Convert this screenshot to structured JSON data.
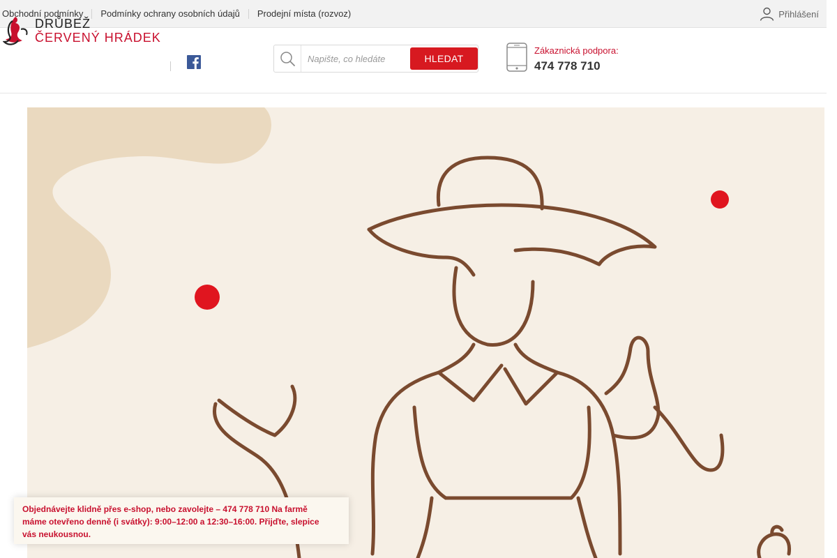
{
  "topbar": {
    "links": [
      "Obchodní podmínky",
      "Podmínky ochrany osobních údajů",
      "Prodejní místa (rozvoz)"
    ],
    "login_label": "Přihlášení",
    "login_icon": "user-icon"
  },
  "header": {
    "logo": {
      "line1": "DRŮBEŽ",
      "line2": "ČERVENÝ HRÁDEK"
    },
    "social_icon": "facebook-icon",
    "search": {
      "placeholder": "Napište, co hledáte",
      "button_label": "HLEDAT",
      "icon": "search-icon"
    },
    "support": {
      "label": "Zákaznická podpora:",
      "phone": "474 778 710",
      "icon": "phone-icon"
    }
  },
  "notice": {
    "part1": " Objednávejte klidně přes e-shop, nebo zavolejte – 474 778 710 ",
    "part2": " Na farmě máme otevřeno denně (i svátky): 9:00–12:00 a 12:30–16:00. Přijďte, slepice vás neukousnou.",
    "close_glyph": "",
    "glyph": ""
  },
  "colors": {
    "brand_red": "#d71920",
    "hero_bg": "#f6efe5",
    "drawing_brown": "#7a4a2f"
  }
}
